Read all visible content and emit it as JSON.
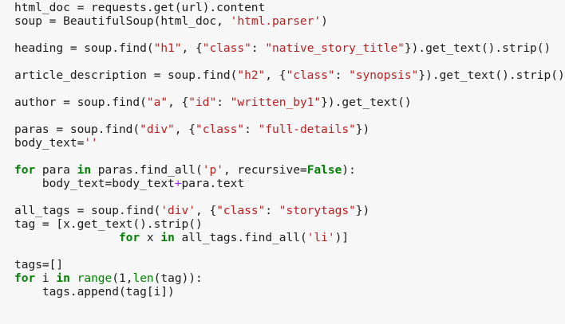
{
  "colors": {
    "background": "#f7f7f7",
    "text": "#1a1a1a",
    "keyword": "#008000",
    "string": "#ba2121",
    "builtin": "#008000",
    "operator": "#aa22ff"
  },
  "lines": [
    [
      {
        "t": "html_doc = requests.get(url).content",
        "k": ""
      }
    ],
    [
      {
        "t": "soup = BeautifulSoup(html_doc, ",
        "k": ""
      },
      {
        "t": "'html.parser'",
        "k": "str"
      },
      {
        "t": ")",
        "k": ""
      }
    ],
    [],
    [
      {
        "t": "heading = soup.find(",
        "k": ""
      },
      {
        "t": "\"h1\"",
        "k": "str"
      },
      {
        "t": ", {",
        "k": ""
      },
      {
        "t": "\"class\"",
        "k": "str"
      },
      {
        "t": ": ",
        "k": ""
      },
      {
        "t": "\"native_story_title\"",
        "k": "str"
      },
      {
        "t": "}).get_text().strip()",
        "k": ""
      }
    ],
    [],
    [
      {
        "t": "article_description = soup.find(",
        "k": ""
      },
      {
        "t": "\"h2\"",
        "k": "str"
      },
      {
        "t": ", {",
        "k": ""
      },
      {
        "t": "\"class\"",
        "k": "str"
      },
      {
        "t": ": ",
        "k": ""
      },
      {
        "t": "\"synopsis\"",
        "k": "str"
      },
      {
        "t": "}).get_text().strip()",
        "k": ""
      }
    ],
    [],
    [
      {
        "t": "author = soup.find(",
        "k": ""
      },
      {
        "t": "\"a\"",
        "k": "str"
      },
      {
        "t": ", {",
        "k": ""
      },
      {
        "t": "\"id\"",
        "k": "str"
      },
      {
        "t": ": ",
        "k": ""
      },
      {
        "t": "\"written_by1\"",
        "k": "str"
      },
      {
        "t": "}).get_text()",
        "k": ""
      }
    ],
    [],
    [
      {
        "t": "paras = soup.find(",
        "k": ""
      },
      {
        "t": "\"div\"",
        "k": "str"
      },
      {
        "t": ", {",
        "k": ""
      },
      {
        "t": "\"class\"",
        "k": "str"
      },
      {
        "t": ": ",
        "k": ""
      },
      {
        "t": "\"full-details\"",
        "k": "str"
      },
      {
        "t": "})",
        "k": ""
      }
    ],
    [
      {
        "t": "body_text=",
        "k": ""
      },
      {
        "t": "''",
        "k": "str"
      }
    ],
    [],
    [
      {
        "t": "for",
        "k": "kw"
      },
      {
        "t": " para ",
        "k": ""
      },
      {
        "t": "in",
        "k": "kw"
      },
      {
        "t": " paras.find_all(",
        "k": ""
      },
      {
        "t": "'p'",
        "k": "str"
      },
      {
        "t": ", recursive=",
        "k": ""
      },
      {
        "t": "False",
        "k": "kw"
      },
      {
        "t": "):",
        "k": ""
      }
    ],
    [
      {
        "t": "    body_text=body_text",
        "k": ""
      },
      {
        "t": "+",
        "k": "op"
      },
      {
        "t": "para.text",
        "k": ""
      }
    ],
    [],
    [
      {
        "t": "all_tags = soup.find(",
        "k": ""
      },
      {
        "t": "'div'",
        "k": "str"
      },
      {
        "t": ", {",
        "k": ""
      },
      {
        "t": "\"class\"",
        "k": "str"
      },
      {
        "t": ": ",
        "k": ""
      },
      {
        "t": "\"storytags\"",
        "k": "str"
      },
      {
        "t": "})",
        "k": ""
      }
    ],
    [
      {
        "t": "tag = [x.get_text().strip()",
        "k": ""
      }
    ],
    [
      {
        "t": "               ",
        "k": ""
      },
      {
        "t": "for",
        "k": "kw"
      },
      {
        "t": " x ",
        "k": ""
      },
      {
        "t": "in",
        "k": "kw"
      },
      {
        "t": " all_tags.find_all(",
        "k": ""
      },
      {
        "t": "'li'",
        "k": "str"
      },
      {
        "t": ")]",
        "k": ""
      }
    ],
    [],
    [
      {
        "t": "tags=[]",
        "k": ""
      }
    ],
    [
      {
        "t": "for",
        "k": "kw"
      },
      {
        "t": " i ",
        "k": ""
      },
      {
        "t": "in",
        "k": "kw"
      },
      {
        "t": " ",
        "k": ""
      },
      {
        "t": "range",
        "k": "bi"
      },
      {
        "t": "(1,",
        "k": ""
      },
      {
        "t": "len",
        "k": "bi"
      },
      {
        "t": "(tag)):",
        "k": ""
      }
    ],
    [
      {
        "t": "    tags.append(tag[i])",
        "k": ""
      }
    ]
  ]
}
